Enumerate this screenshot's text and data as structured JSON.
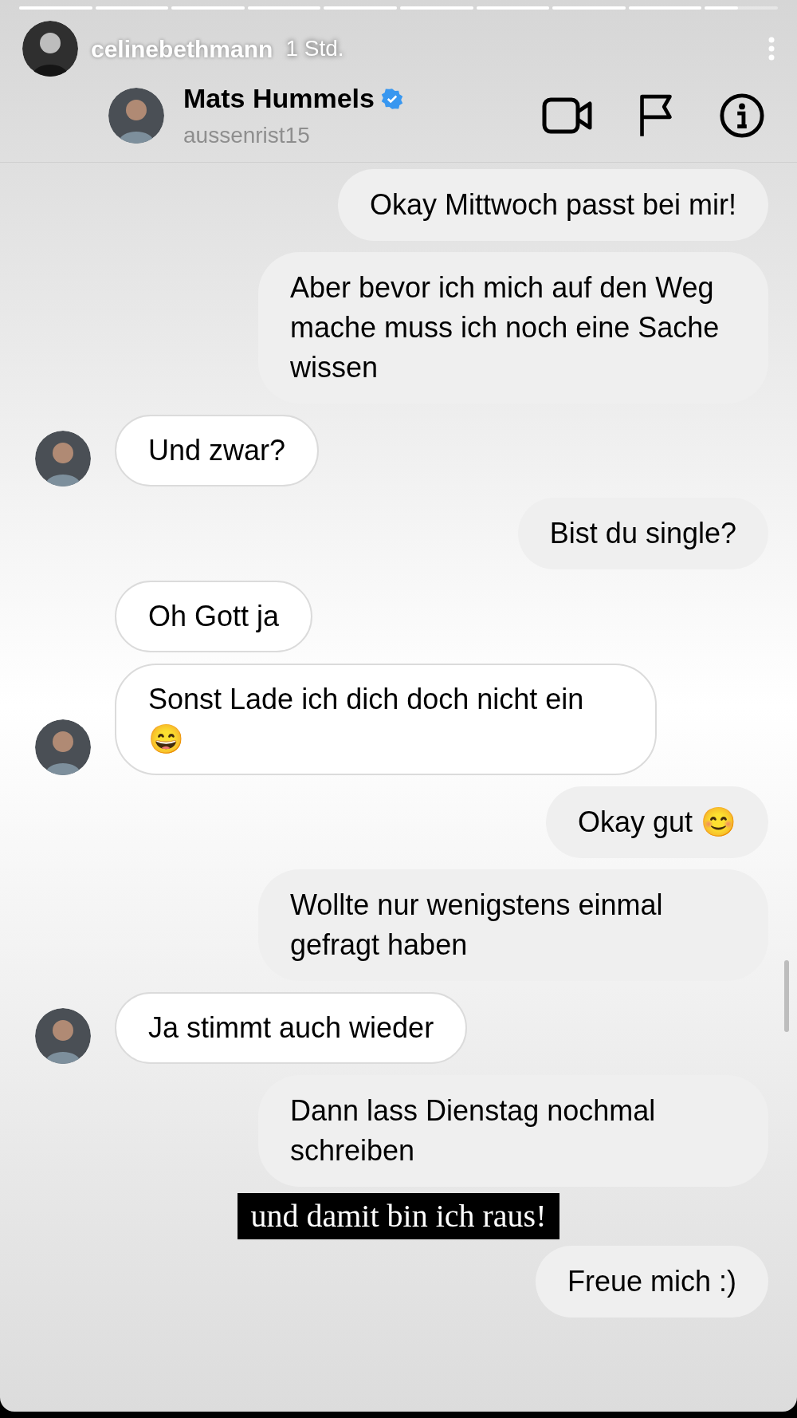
{
  "story": {
    "segments": [
      {
        "level": 1
      },
      {
        "level": 1
      },
      {
        "level": 1
      },
      {
        "level": 1
      },
      {
        "level": 1
      },
      {
        "level": 1
      },
      {
        "level": 1
      },
      {
        "level": 1
      },
      {
        "level": 1
      },
      {
        "level": 0.45
      }
    ],
    "username": "celinebethmann",
    "time": "1 Std."
  },
  "chat_header": {
    "name": "Mats Hummels",
    "verified": true,
    "handle": "aussenrist15"
  },
  "messages": [
    {
      "kind": "outgoing",
      "text": "Okay Mittwoch passt bei mir!"
    },
    {
      "kind": "outgoing",
      "text": "Aber bevor ich mich auf den Weg mache muss ich noch eine Sache wissen"
    },
    {
      "kind": "incoming",
      "text": "Und zwar?",
      "avatar": true
    },
    {
      "kind": "outgoing",
      "text": "Bist du single?"
    },
    {
      "kind": "incoming",
      "text": "Oh Gott ja",
      "avatar": false
    },
    {
      "kind": "incoming",
      "text": "Sonst Lade ich dich doch nicht ein 😄",
      "avatar": true
    },
    {
      "kind": "outgoing",
      "text": "Okay gut 😊"
    },
    {
      "kind": "outgoing",
      "text": "Wollte nur wenigstens einmal gefragt haben"
    },
    {
      "kind": "incoming",
      "text": "Ja stimmt auch wieder",
      "avatar": true
    },
    {
      "kind": "outgoing",
      "text": "Dann lass Dienstag nochmal schreiben"
    },
    {
      "kind": "caption",
      "text": "und damit bin ich raus!"
    },
    {
      "kind": "outgoing",
      "text": "Freue mich :)"
    }
  ]
}
